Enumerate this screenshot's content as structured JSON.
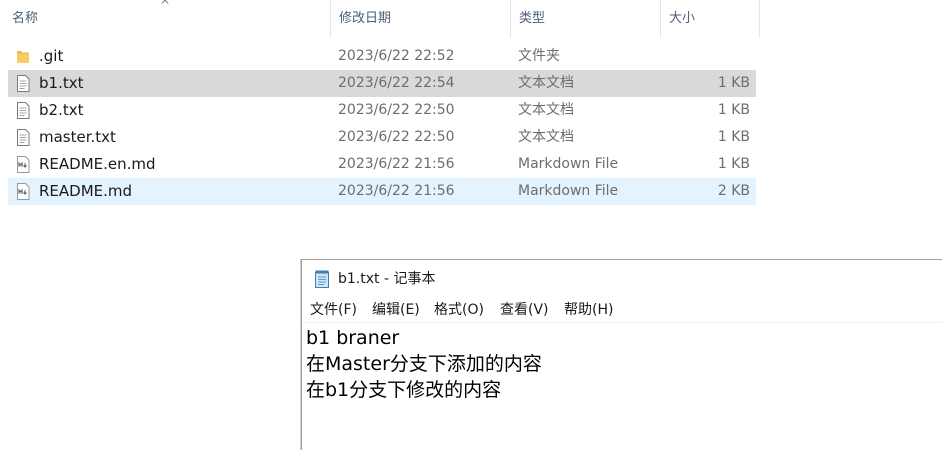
{
  "explorer": {
    "columns": {
      "name": "名称",
      "date": "修改日期",
      "type": "类型",
      "size": "大小"
    },
    "sort_indicator": "^",
    "files": [
      {
        "name": ".git",
        "date": "2023/6/22 22:52",
        "type": "文件夹",
        "size": "",
        "icon": "folder-icon",
        "state": "normal"
      },
      {
        "name": "b1.txt",
        "date": "2023/6/22 22:54",
        "type": "文本文档",
        "size": "1 KB",
        "icon": "text-file-icon",
        "state": "selected"
      },
      {
        "name": "b2.txt",
        "date": "2023/6/22 22:50",
        "type": "文本文档",
        "size": "1 KB",
        "icon": "text-file-icon",
        "state": "normal"
      },
      {
        "name": "master.txt",
        "date": "2023/6/22 22:50",
        "type": "文本文档",
        "size": "1 KB",
        "icon": "text-file-icon",
        "state": "normal"
      },
      {
        "name": "README.en.md",
        "date": "2023/6/22 21:56",
        "type": "Markdown File",
        "size": "1 KB",
        "icon": "markdown-file-icon",
        "state": "normal"
      },
      {
        "name": "README.md",
        "date": "2023/6/22 21:56",
        "type": "Markdown File",
        "size": "2 KB",
        "icon": "markdown-file-icon",
        "state": "hover"
      }
    ]
  },
  "notepad": {
    "title": "b1.txt - 记事本",
    "icon": "notepad-icon",
    "menu": [
      {
        "label": "文件(F)"
      },
      {
        "label": "编辑(E)"
      },
      {
        "label": "格式(O)"
      },
      {
        "label": "查看(V)"
      },
      {
        "label": "帮助(H)"
      }
    ],
    "lines": [
      "b1 braner",
      "在Master分支下添加的内容",
      "在b1分支下修改的内容"
    ]
  },
  "colors": {
    "selected_row": "#d9d9d9",
    "hover_row": "#e5f3ff",
    "header_text": "#4c607a",
    "meta_text": "#6d6d6d",
    "folder": "#e8b84a"
  }
}
